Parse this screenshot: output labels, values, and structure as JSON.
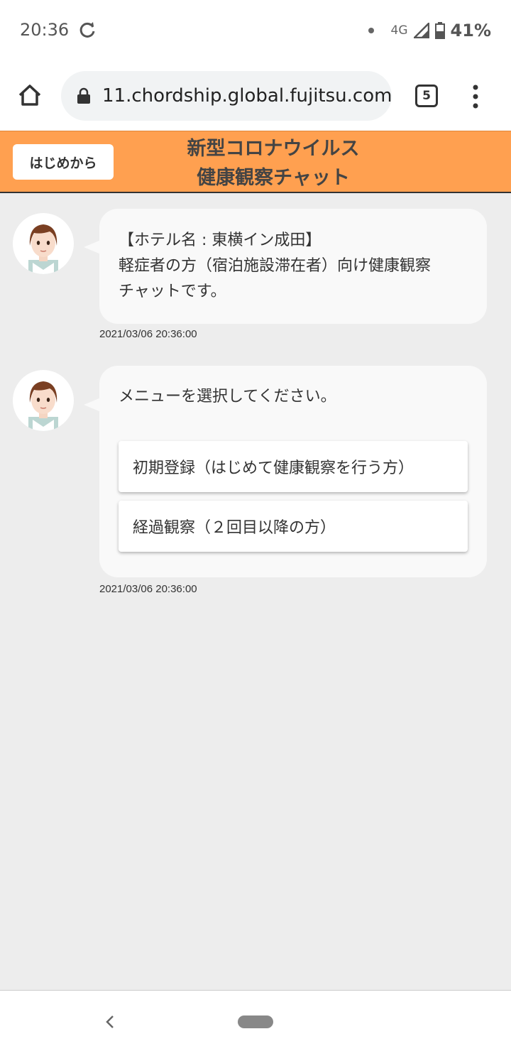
{
  "status_bar": {
    "time": "20:36",
    "network": "4G",
    "battery": "41%",
    "icons": [
      "sync-icon",
      "notification-dot-icon",
      "signal-icon",
      "battery-icon"
    ]
  },
  "browser": {
    "url": "11.chordship.global.fujitsu.com",
    "tab_count": "5",
    "icons": [
      "home-icon",
      "lock-icon",
      "tabs-icon",
      "more-vert-icon"
    ]
  },
  "header": {
    "restart_label": "はじめから",
    "title_line1": "新型コロナウイルス",
    "title_line2": "健康観察チャット",
    "color": "#ffa050"
  },
  "messages": [
    {
      "lines": [
        "【ホテル名 : 東横イン成田】",
        "軽症者の方（宿泊施設滞在者）向け健康観察",
        "チャットです。"
      ],
      "timestamp": "2021/03/06 20:36:00"
    },
    {
      "lines": [
        "メニューを選択してください。"
      ],
      "options": [
        "初期登録（はじめて健康観察を行う方）",
        "経過観察（２回目以降の方）"
      ],
      "timestamp": "2021/03/06 20:36:00"
    }
  ],
  "nav": {
    "icons": [
      "back-icon",
      "home-pill-icon"
    ]
  }
}
